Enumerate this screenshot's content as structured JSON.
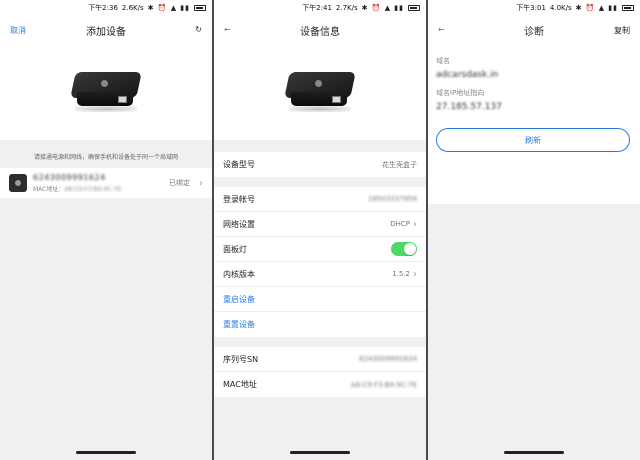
{
  "screens": [
    {
      "status": {
        "time": "下午2:36",
        "speed": "2.6K/s"
      },
      "nav": {
        "left": "取消",
        "title": "添加设备"
      },
      "hint": "请接通电源和网线，确保手机和设备处于同一个局域网",
      "device": {
        "name": "6243009991624",
        "mac_label": "MAC地址：",
        "mac_value": "A8:C9:F3:B4:9C:7E",
        "status": "已绑定"
      }
    },
    {
      "status": {
        "time": "下午2:41",
        "speed": "2.7K/s"
      },
      "nav": {
        "title": "设备信息"
      },
      "rows": {
        "model": {
          "label": "设备型号",
          "value": "花生壳盒子"
        },
        "account": {
          "label": "登录帐号",
          "value": "18503337959"
        },
        "network": {
          "label": "网络设置",
          "value": "DHCP"
        },
        "panel_light": {
          "label": "面板灯",
          "on": true
        },
        "kernel": {
          "label": "内核版本",
          "value": "1.5.2"
        },
        "reboot": {
          "label": "重启设备"
        },
        "reset": {
          "label": "重置设备"
        },
        "serial": {
          "label": "序列号SN",
          "value": "6243009991624"
        },
        "mac": {
          "label": "MAC地址",
          "value": "A8:C9:F3:B4:9C:7E"
        }
      }
    },
    {
      "status": {
        "time": "下午3:01",
        "speed": "4.0K/s"
      },
      "nav": {
        "title": "诊断",
        "right": "复制"
      },
      "domain": {
        "label": "域名",
        "value": "adcarsdask.in"
      },
      "ip": {
        "label": "域名IP地址指向",
        "value": "27.185.57.137"
      },
      "refresh_label": "刷新"
    }
  ],
  "colors": {
    "accent": "#2a7be0",
    "toggle_on": "#4cd964"
  },
  "icons": [
    "refresh-icon",
    "back-arrow-icon",
    "chevron-right-icon",
    "device-icon"
  ]
}
